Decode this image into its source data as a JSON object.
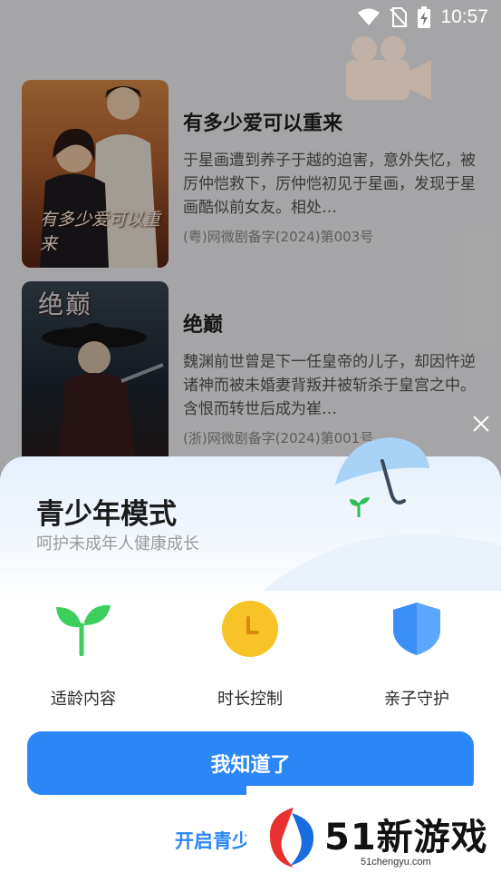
{
  "status_bar": {
    "time": "10:57"
  },
  "dramas": [
    {
      "poster_text": "有多少爱可以重来",
      "title": "有多少爱可以重来",
      "description": "于星画遭到养子于越的迫害，意外失忆，被厉仲恺救下，厉仲恺初见于星画，发现于星画酷似前女友。相处…",
      "record": "(粤)网微剧备字(2024)第003号"
    },
    {
      "poster_text": "绝巅",
      "title": "绝巅",
      "description": "魏渊前世曾是下一任皇帝的儿子，却因忤逆诸神而被未婚妻背叛并被斩杀于皇宫之中。含恨而转世后成为崔…",
      "record": "(浙)网微剧备字(2024)第001号"
    }
  ],
  "teen_mode": {
    "title": "青少年模式",
    "subtitle": "呵护未成年人健康成长",
    "features": [
      {
        "label": "适龄内容",
        "icon": "sprout-icon"
      },
      {
        "label": "时长控制",
        "icon": "clock-icon"
      },
      {
        "label": "亲子守护",
        "icon": "shield-icon"
      }
    ],
    "confirm_button": "我知道了",
    "enable_link": "开启青少"
  },
  "watermark": {
    "title": "51新游戏",
    "url": "51chengyu.com"
  },
  "colors": {
    "accent": "#2b86f7",
    "sprout": "#3ccf5e",
    "clock": "#f7c326",
    "shield": "#3a8ef6"
  }
}
